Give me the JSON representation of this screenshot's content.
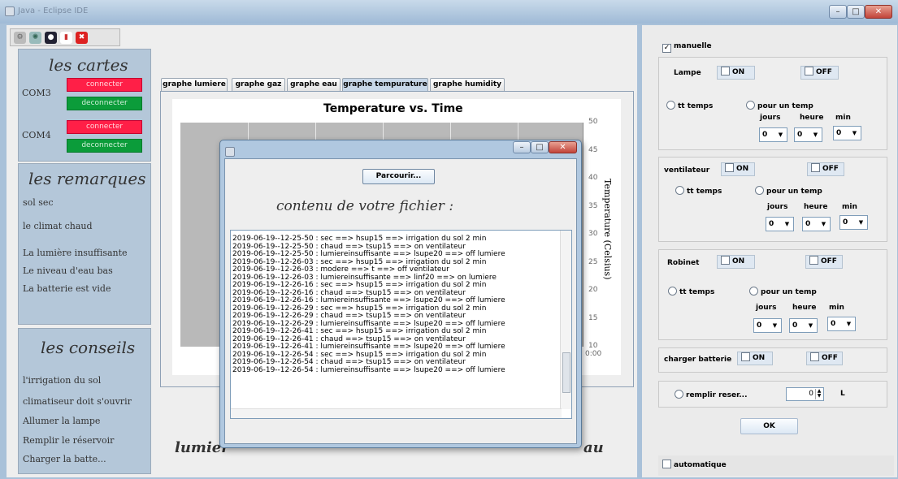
{
  "window": {
    "title": "Java - Eclipse IDE"
  },
  "toolbar": {
    "icons": [
      "settings-icon",
      "gear-icon",
      "record-icon",
      "chart-icon",
      "close-icon"
    ]
  },
  "cartes": {
    "title": "les cartes",
    "ports": [
      {
        "name": "COM3",
        "connect": "connecter",
        "disconnect": "deconnecter"
      },
      {
        "name": "COM4",
        "connect": "connecter",
        "disconnect": "deconnecter"
      }
    ]
  },
  "remarques": {
    "title": "les remarques",
    "items": [
      "sol sec",
      "le climat chaud",
      "La lumière insuffisante",
      "Le niveau d'eau bas",
      "La batterie est vide"
    ]
  },
  "conseils": {
    "title": "les conseils",
    "items": [
      "l'irrigation du sol",
      "climatiseur doit s'ouvrir",
      "Allumer la lampe",
      "Remplir le réservoir",
      "Charger la batte..."
    ]
  },
  "tabs": [
    "graphe lumiere",
    "graphe gaz",
    "graphe eau",
    "graphe tempurature",
    "graphe humidity"
  ],
  "selected_tab": 3,
  "chart_data": {
    "type": "line",
    "title": "Temperature vs. Time",
    "ylabel": "Temperature (Celsius)",
    "ylim": [
      10,
      50
    ],
    "yticks": [
      "50",
      "45",
      "40",
      "35",
      "30",
      "25",
      "20",
      "15",
      "10"
    ],
    "xticks": [
      "0:00"
    ],
    "series": []
  },
  "bottom_label": {
    "left": "lumier",
    "right": "au"
  },
  "right": {
    "manuelle": {
      "label": "manuelle",
      "checked": true
    },
    "lampe": {
      "label": "Lampe",
      "on": "ON",
      "off": "OFF",
      "tt_temps": "tt temps",
      "pour_un_temp": "pour un temp",
      "jours": "jours",
      "heure": "heure",
      "min": "min",
      "values": [
        "0",
        "0",
        "0"
      ]
    },
    "ventilateur": {
      "label": "ventilateur",
      "on": "ON",
      "off": "OFF",
      "tt_temps": "tt temps",
      "pour_un_temp": "pour un temp",
      "jours": "jours",
      "heure": "heure",
      "min": "min",
      "values": [
        "0",
        "0",
        "0"
      ]
    },
    "robinet": {
      "label": "Robinet",
      "on": "ON",
      "off": "OFF",
      "tt_temps": "tt temps",
      "pour_un_temp": "pour un temp",
      "jours": "jours",
      "heure": "heure",
      "min": "min",
      "values": [
        "0",
        "0",
        "0"
      ]
    },
    "batterie": {
      "label": "charger batterie",
      "on": "ON",
      "off": "OFF"
    },
    "reservoir": {
      "label": "remplir reser...",
      "value": "0",
      "unit": "L"
    },
    "ok": "OK",
    "automatique": "automatique"
  },
  "dialog": {
    "browse": "Parcourir...",
    "heading": "contenu de votre fichier :",
    "lines": [
      "2019-06-19--12-25-50 : sec ==> hsup15 ==> irrigation du sol 2 min",
      "2019-06-19--12-25-50 : chaud ==> tsup15 ==> on ventilateur",
      "2019-06-19--12-25-50 : lumiereinsuffisante ==> lsupe20 ==> off lumiere",
      "2019-06-19--12-26-03 : sec ==> hsup15 ==> irrigation du sol 2 min",
      "2019-06-19--12-26-03 : modere ==> t ==> off ventilateur",
      "2019-06-19--12-26-03 : lumiereinsuffisante ==> linf20 ==> on lumiere",
      "2019-06-19--12-26-16 : sec ==> hsup15 ==> irrigation du sol 2 min",
      "2019-06-19--12-26-16 : chaud ==> tsup15 ==> on ventilateur",
      "2019-06-19--12-26-16 : lumiereinsuffisante ==> lsupe20 ==> off lumiere",
      "2019-06-19--12-26-29 : sec ==> hsup15 ==> irrigation du sol 2 min",
      "2019-06-19--12-26-29 : chaud ==> tsup15 ==> on ventilateur",
      "2019-06-19--12-26-29 : lumiereinsuffisante ==> lsupe20 ==> off lumiere",
      "2019-06-19--12-26-41 : sec ==> hsup15 ==> irrigation du sol 2 min",
      "2019-06-19--12-26-41 : chaud ==> tsup15 ==> on ventilateur",
      "2019-06-19--12-26-41 : lumiereinsuffisante ==> lsupe20 ==> off lumiere",
      "2019-06-19--12-26-54 : sec ==> hsup15 ==> irrigation du sol 2 min",
      "2019-06-19--12-26-54 : chaud ==> tsup15 ==> on ventilateur",
      "2019-06-19--12-26-54 : lumiereinsuffisante ==> lsupe20 ==> off lumiere"
    ]
  }
}
